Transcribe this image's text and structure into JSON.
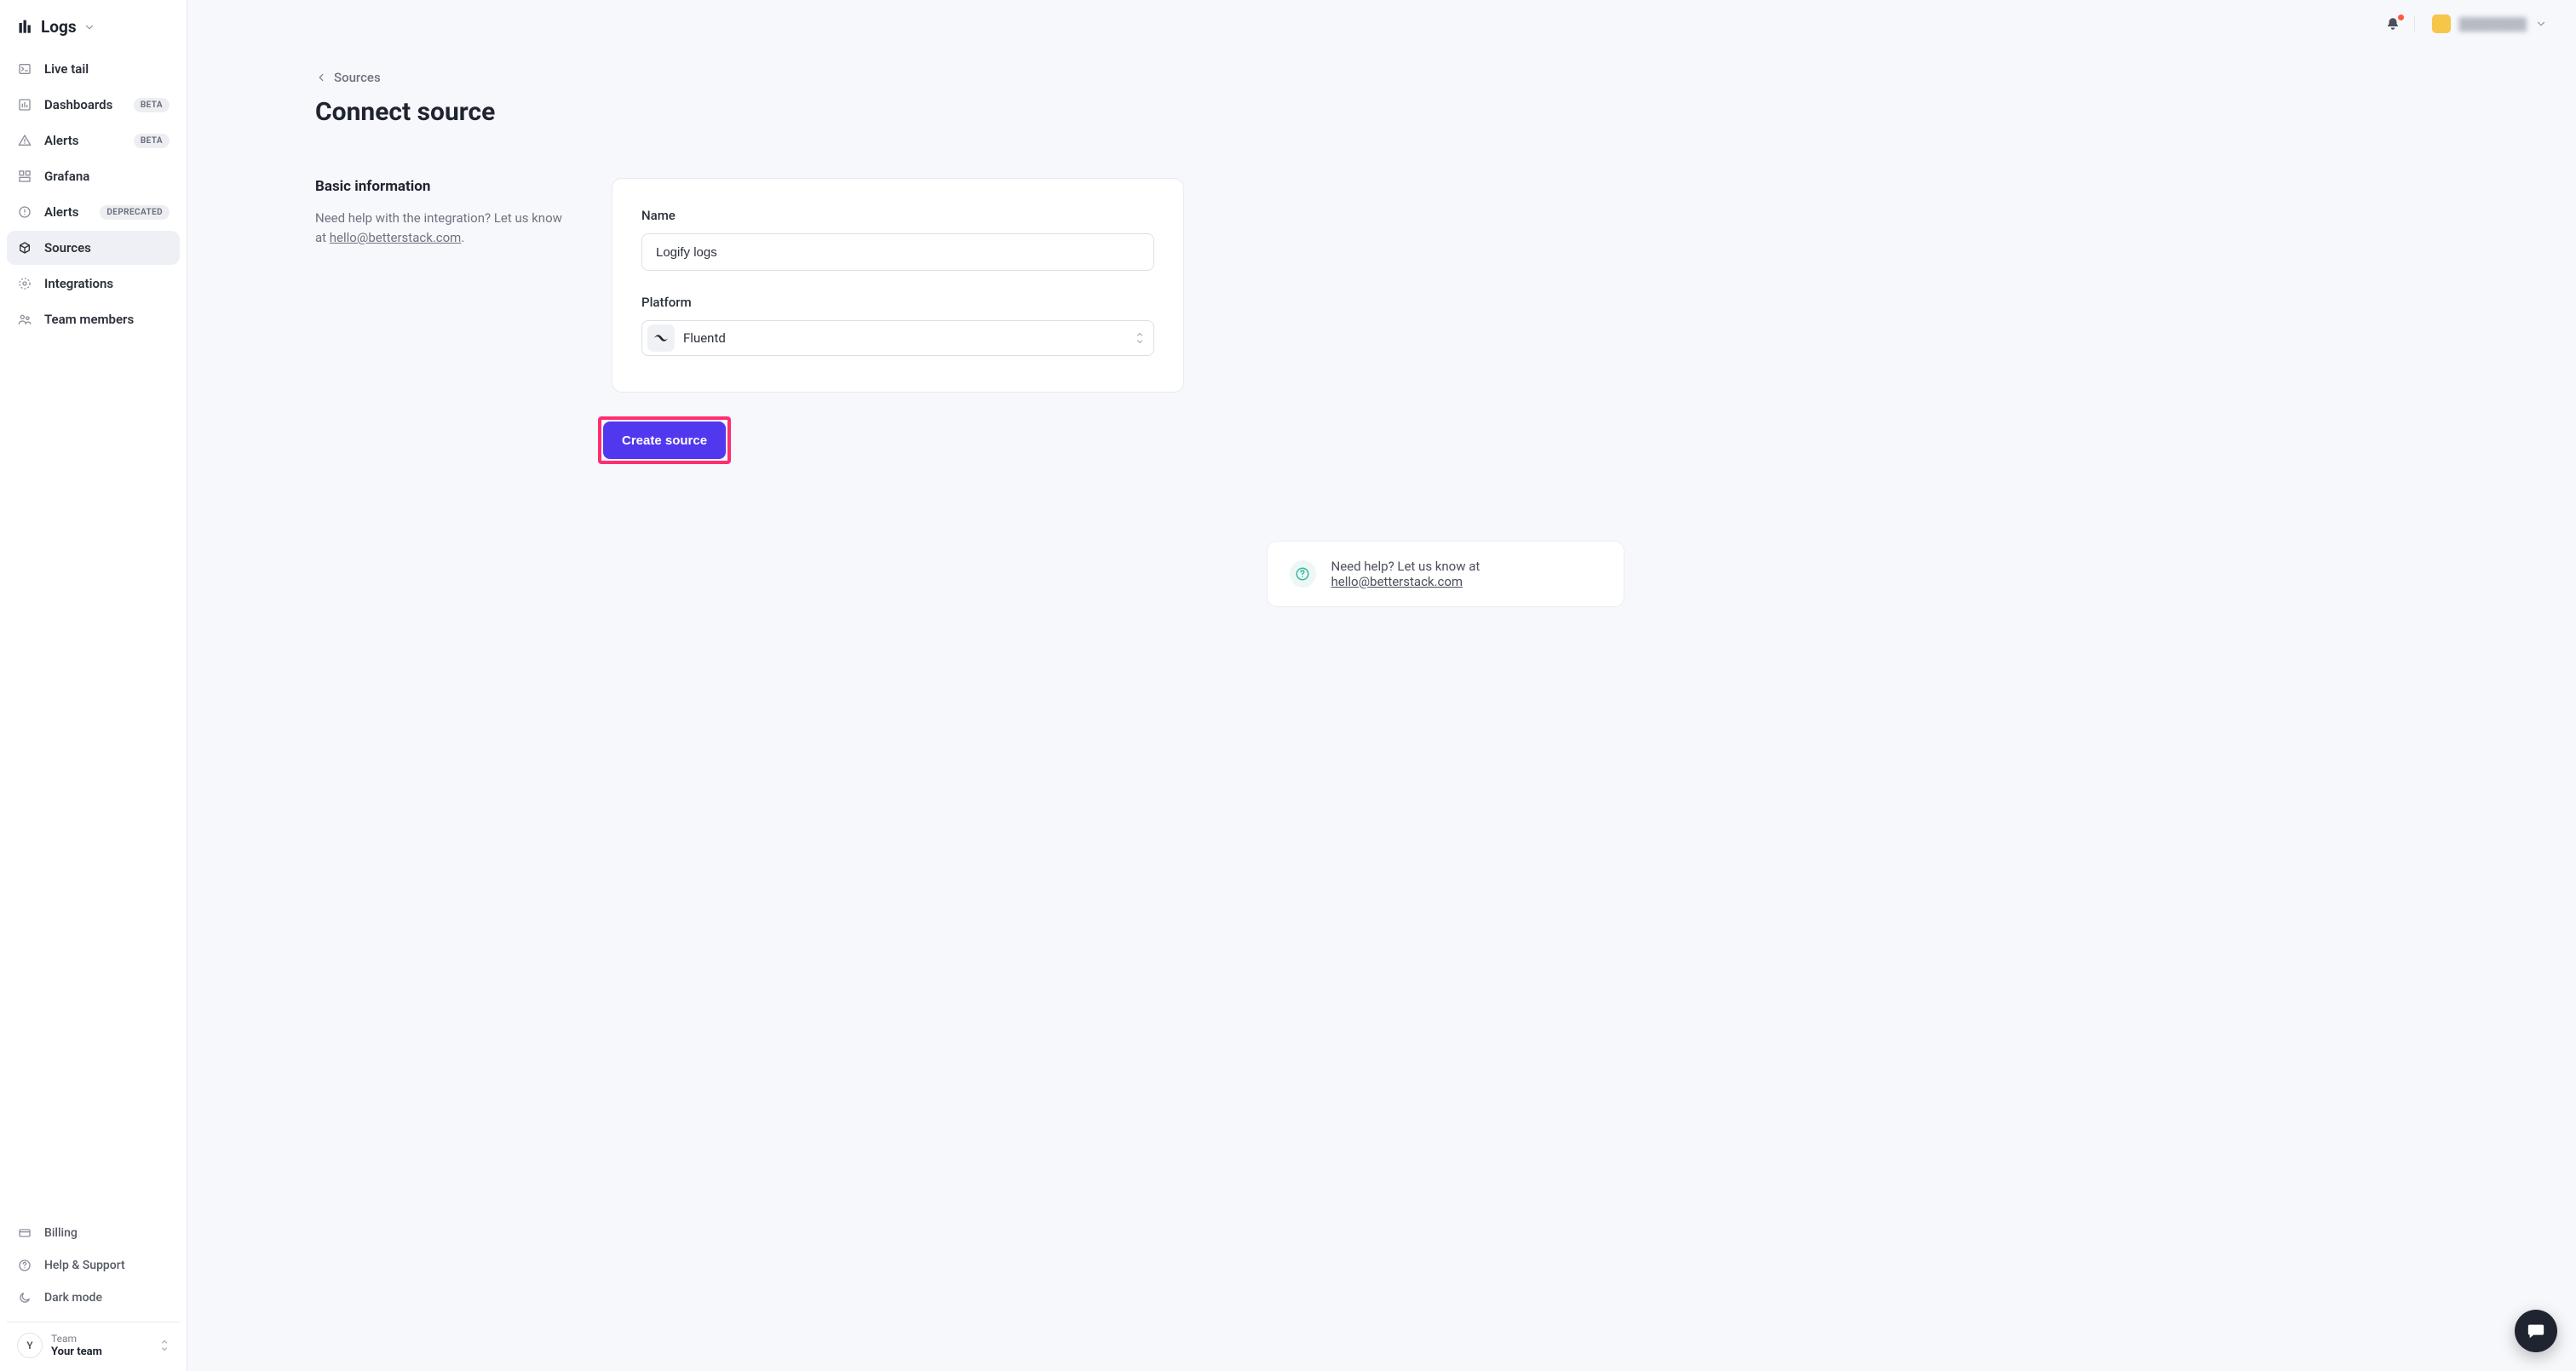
{
  "brand": {
    "name": "Logs"
  },
  "sidebar": {
    "items": [
      {
        "label": "Live tail",
        "badge": null,
        "selected": false
      },
      {
        "label": "Dashboards",
        "badge": "BETA",
        "selected": false
      },
      {
        "label": "Alerts",
        "badge": "BETA",
        "selected": false
      },
      {
        "label": "Grafana",
        "badge": null,
        "selected": false
      },
      {
        "label": "Alerts",
        "badge": "DEPRECATED",
        "selected": false
      },
      {
        "label": "Sources",
        "badge": null,
        "selected": true
      },
      {
        "label": "Integrations",
        "badge": null,
        "selected": false
      },
      {
        "label": "Team members",
        "badge": null,
        "selected": false
      }
    ],
    "footer": {
      "billing": "Billing",
      "help": "Help & Support",
      "darkmode": "Dark mode"
    },
    "team": {
      "avatar_letter": "Y",
      "label": "Team",
      "name": "Your team"
    }
  },
  "topbar": {
    "user_name": "████████"
  },
  "page": {
    "breadcrumb": "Sources",
    "title": "Connect source",
    "section": {
      "heading": "Basic information",
      "help_prefix": "Need help with the integration? Let us know at ",
      "help_email": "hello@betterstack.com",
      "help_suffix": "."
    },
    "form": {
      "name_label": "Name",
      "name_value": "Logify logs",
      "platform_label": "Platform",
      "platform_value": "Fluentd"
    },
    "submit_label": "Create source",
    "footer_help_prefix": "Need help? Let us know at ",
    "footer_help_email": "hello@betterstack.com"
  }
}
